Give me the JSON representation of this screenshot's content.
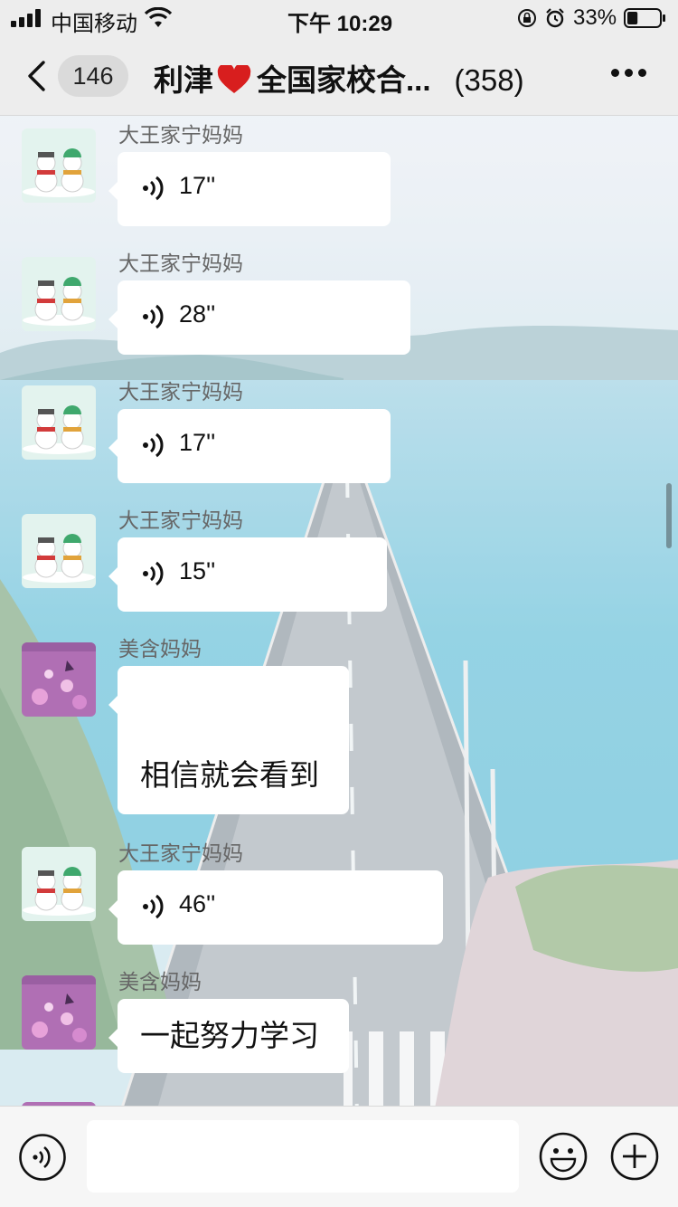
{
  "status_bar": {
    "carrier": "中国移动",
    "time": "下午 10:29",
    "battery_percent": "33%",
    "battery_level": 0.33,
    "icons": [
      "signal-icon",
      "wifi-icon",
      "orientation-lock-icon",
      "alarm-icon",
      "battery-icon"
    ]
  },
  "nav_bar": {
    "unread_count": "146",
    "title_part1": "利津",
    "title_part2": "全国家校合...",
    "member_count": "(358)",
    "icons": [
      "back-icon",
      "heart-icon",
      "more-icon"
    ]
  },
  "messages": [
    {
      "sender": "大王家宁妈妈",
      "type": "voice",
      "duration": "17''",
      "avatar": "snowman-avatar"
    },
    {
      "sender": "大王家宁妈妈",
      "type": "voice",
      "duration": "28''",
      "avatar": "snowman-avatar"
    },
    {
      "sender": "大王家宁妈妈",
      "type": "voice",
      "duration": "17''",
      "avatar": "snowman-avatar"
    },
    {
      "sender": "大王家宁妈妈",
      "type": "voice",
      "duration": "15''",
      "avatar": "snowman-avatar"
    },
    {
      "sender": "美含妈妈",
      "type": "text",
      "text": "相信就会看到",
      "avatar": "flower-avatar"
    },
    {
      "sender": "大王家宁妈妈",
      "type": "voice",
      "duration": "46''",
      "avatar": "snowman-avatar"
    },
    {
      "sender": "美含妈妈",
      "type": "text",
      "text": "一起努力学习",
      "avatar": "flower-avatar"
    },
    {
      "sender": "美含妈妈",
      "type": "partial",
      "avatar": "flower-avatar"
    }
  ],
  "input_bar": {
    "placeholder": "",
    "icons": [
      "voice-toggle-icon",
      "emoji-icon",
      "plus-icon"
    ]
  },
  "colors": {
    "nav_background": "#ededed",
    "bubble": "#ffffff",
    "heart": "#d81e1e",
    "avatar_snowman_bg": "#e3f3ee",
    "avatar_flower_bg": "#b06fb4"
  }
}
